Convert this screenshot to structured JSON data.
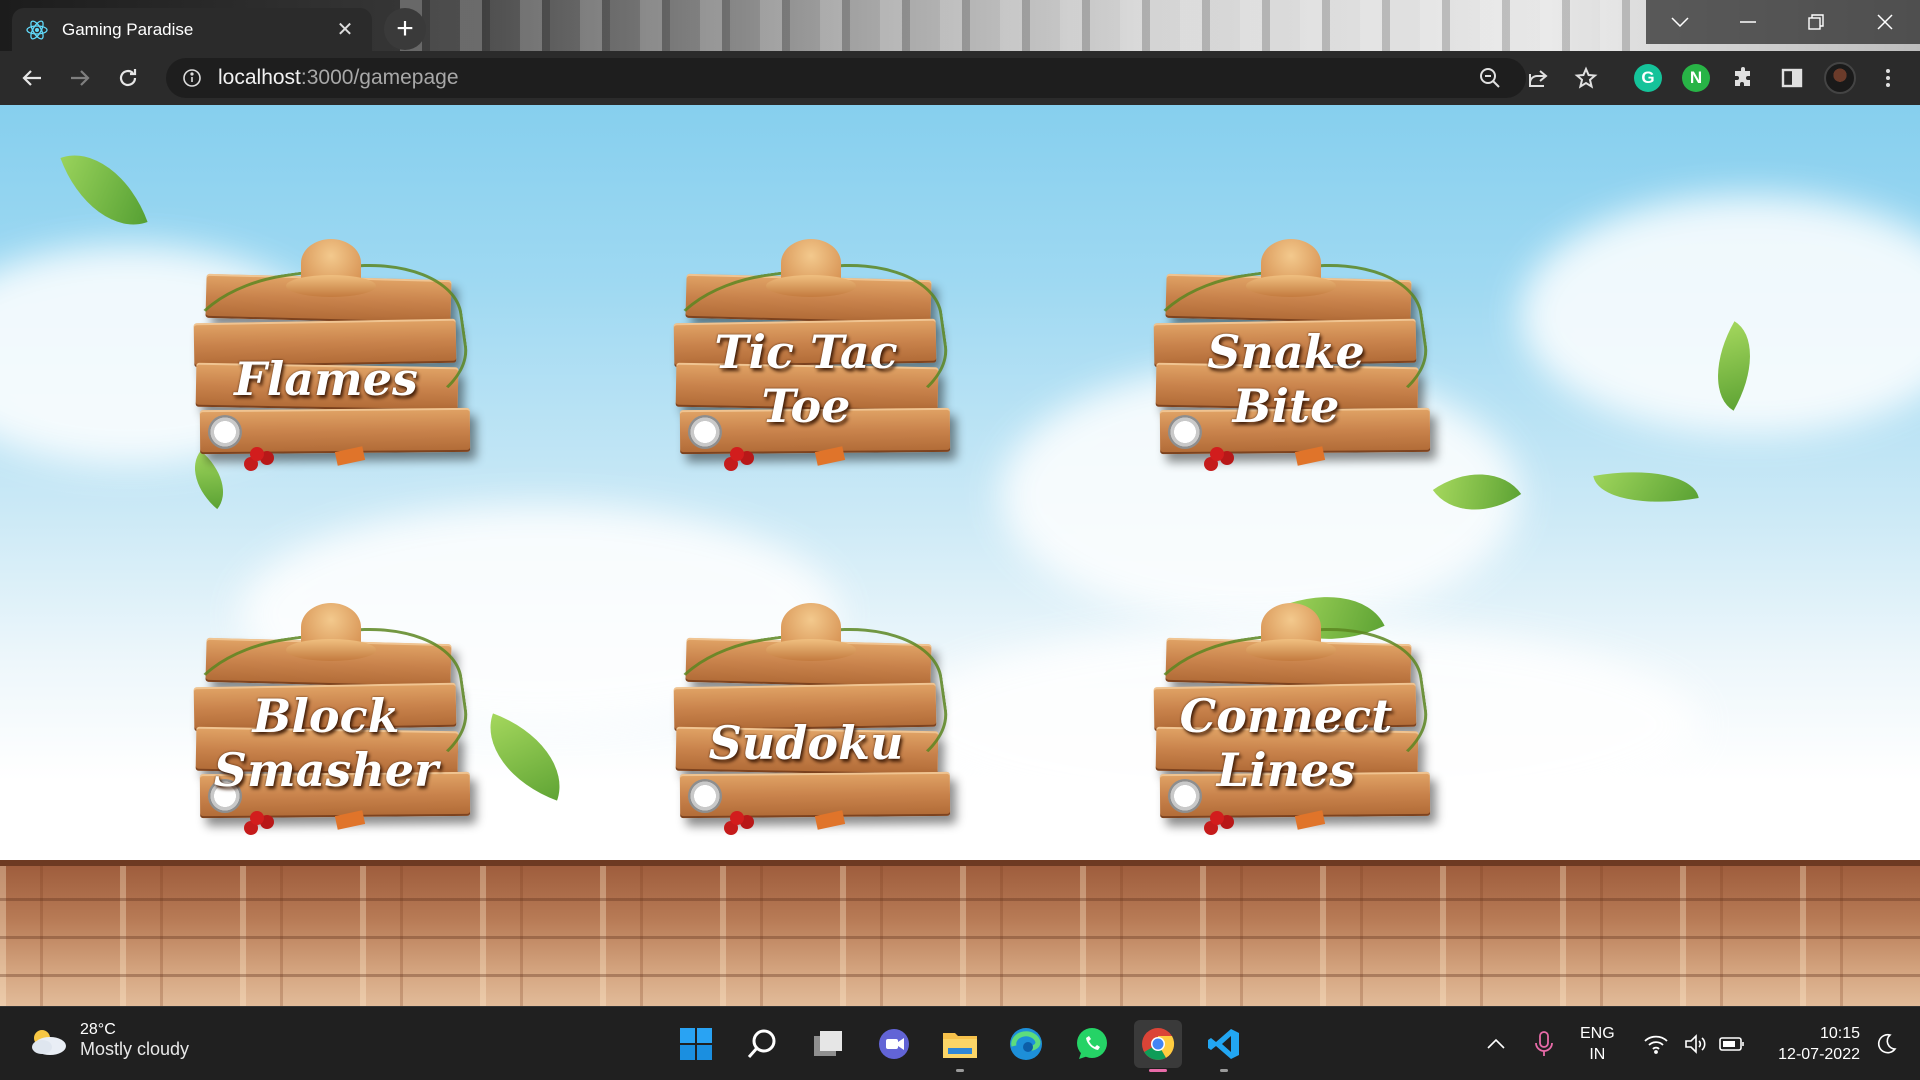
{
  "browser": {
    "tab_title": "Gaming Paradise",
    "tab_favicon": "react-icon",
    "new_tab": "+",
    "url_host": "localhost",
    "url_path": ":3000/gamepage",
    "toolbar_icons": [
      "zoom-out-icon",
      "share-icon",
      "star-icon",
      "grammarly-icon",
      "extension-n-icon",
      "puzzle-icon",
      "sidebar-icon",
      "profile-avatar",
      "menu-icon"
    ],
    "extension_g": "G",
    "extension_n": "N"
  },
  "games": [
    {
      "line1": "Flames",
      "line2": ""
    },
    {
      "line1": "Tic Tac",
      "line2": "Toe"
    },
    {
      "line1": "Snake",
      "line2": "Bite"
    },
    {
      "line1": "Block",
      "line2": "Smasher"
    },
    {
      "line1": "Sudoku",
      "line2": ""
    },
    {
      "line1": "Connect",
      "line2": "Lines"
    }
  ],
  "taskbar": {
    "weather_temp": "28°C",
    "weather_cond": "Mostly cloudy",
    "lang_top": "ENG",
    "lang_bottom": "IN",
    "time": "10:15",
    "date": "12-07-2022",
    "apps": [
      "windows-start-icon",
      "search-icon",
      "task-view-icon",
      "teams-chat-icon",
      "file-explorer-icon",
      "edge-icon",
      "whatsapp-icon",
      "chrome-icon",
      "vscode-icon"
    ]
  },
  "colors": {
    "sky": "#86cfee",
    "wood": "#c9834c",
    "taskbar": "#202020",
    "browser_chrome": "#2b2b2b"
  }
}
